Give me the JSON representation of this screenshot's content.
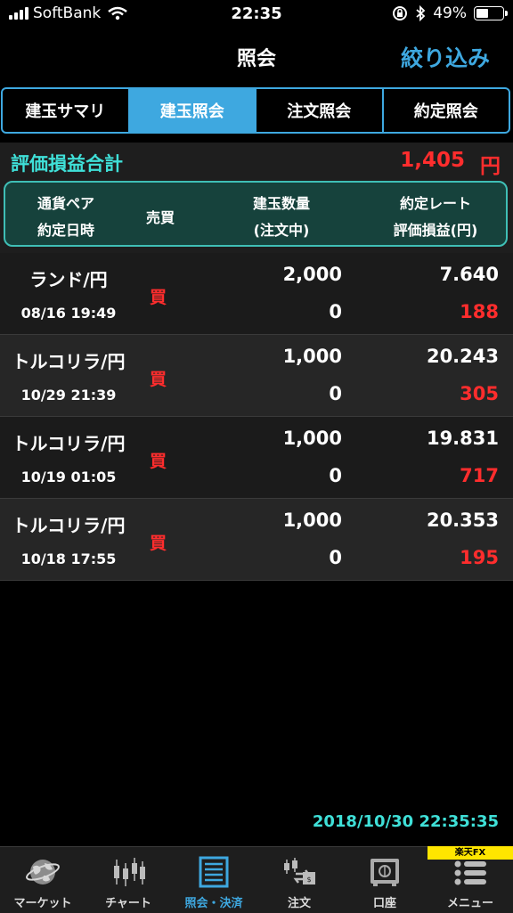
{
  "status_bar": {
    "carrier": "SoftBank",
    "time": "22:35",
    "battery": "49%",
    "battery_level": 0.49
  },
  "nav": {
    "title": "照会",
    "filter_label": "絞り込み"
  },
  "tabs": [
    {
      "label": "建玉サマリ",
      "active": false
    },
    {
      "label": "建玉照会",
      "active": true
    },
    {
      "label": "注文照会",
      "active": false
    },
    {
      "label": "約定照会",
      "active": false
    }
  ],
  "summary": {
    "label": "評価損益合計",
    "value": "1,405",
    "unit": "円"
  },
  "header": {
    "pair": "通貨ペア",
    "date": "約定日時",
    "side": "売買",
    "qty": "建玉数量",
    "pending": "(注文中)",
    "rate": "約定レート",
    "pl": "評価損益(円)"
  },
  "rows": [
    {
      "pair": "ランド/円",
      "date": "08/16 19:49",
      "side": "買",
      "qty": "2,000",
      "pending": "0",
      "rate": "7.640",
      "pl": "188"
    },
    {
      "pair": "トルコリラ/円",
      "date": "10/29 21:39",
      "side": "買",
      "qty": "1,000",
      "pending": "0",
      "rate": "20.243",
      "pl": "305"
    },
    {
      "pair": "トルコリラ/円",
      "date": "10/19 01:05",
      "side": "買",
      "qty": "1,000",
      "pending": "0",
      "rate": "19.831",
      "pl": "717"
    },
    {
      "pair": "トルコリラ/円",
      "date": "10/18 17:55",
      "side": "買",
      "qty": "1,000",
      "pending": "0",
      "rate": "20.353",
      "pl": "195"
    }
  ],
  "timestamp": "2018/10/30 22:35:35",
  "brand": "楽天FX",
  "tabbar": [
    {
      "label": "マーケット",
      "icon": "globe-icon"
    },
    {
      "label": "チャート",
      "icon": "candlestick-icon"
    },
    {
      "label": "照会・決済",
      "icon": "list-icon",
      "active": true
    },
    {
      "label": "注文",
      "icon": "order-icon"
    },
    {
      "label": "口座",
      "icon": "safe-icon"
    },
    {
      "label": "メニュー",
      "icon": "menu-icon"
    }
  ],
  "colors": {
    "accent": "#3ea8e0",
    "teal": "#3fe0d8",
    "negative_red": "#ff2d2d",
    "header_bg": "#16423c"
  }
}
